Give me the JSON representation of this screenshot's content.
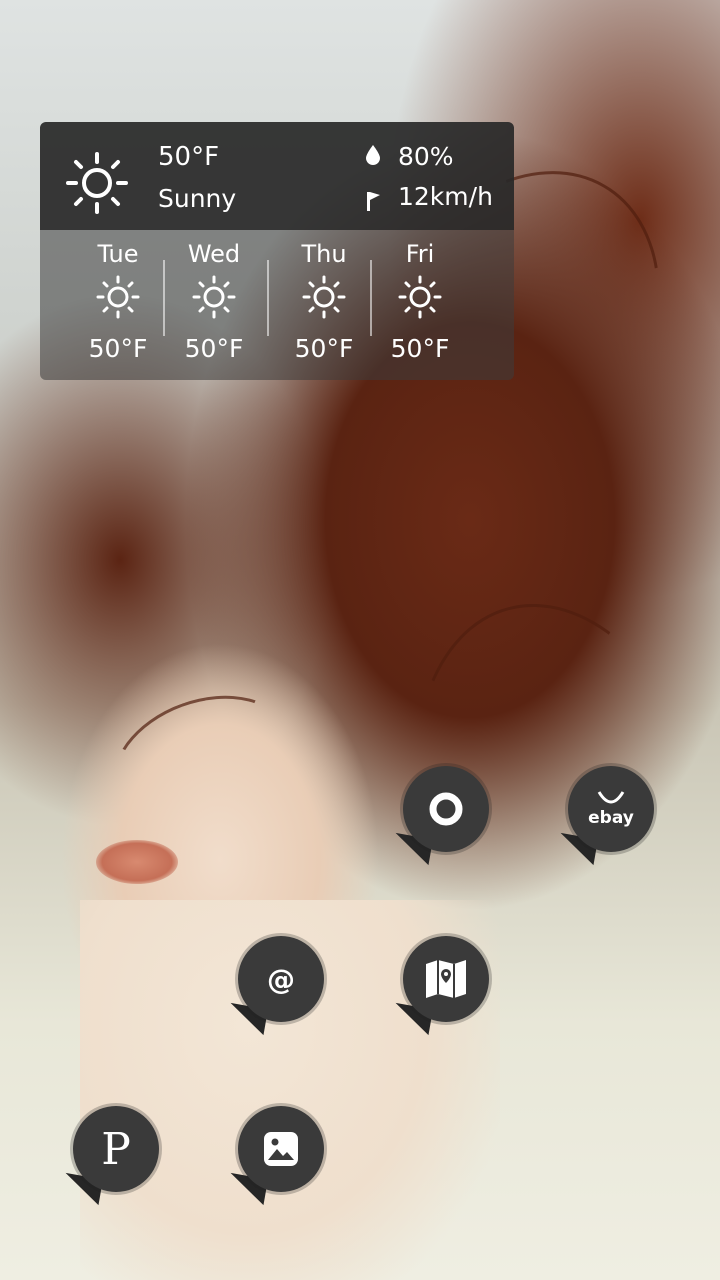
{
  "weather": {
    "current": {
      "temperature": "50°F",
      "condition": "Sunny",
      "humidity": "80%",
      "wind": "12km/h",
      "icon": "sun-icon"
    },
    "forecast": [
      {
        "day": "Tue",
        "temp": "50°F",
        "icon": "sun-icon"
      },
      {
        "day": "Wed",
        "temp": "50°F",
        "icon": "sun-icon"
      },
      {
        "day": "Thu",
        "temp": "50°F",
        "icon": "sun-icon"
      },
      {
        "day": "Fri",
        "temp": "50°F",
        "icon": "sun-icon"
      }
    ]
  },
  "apps": [
    {
      "name": "opera",
      "icon": "opera-ring-icon"
    },
    {
      "name": "ebay",
      "icon": "ebay-icon",
      "logo_text": "ebay"
    },
    {
      "name": "email",
      "icon": "at-sign-icon",
      "glyph": "@"
    },
    {
      "name": "maps",
      "icon": "folded-map-icon"
    },
    {
      "name": "pinterest",
      "icon": "pinterest-p-icon",
      "glyph": "P"
    },
    {
      "name": "gallery",
      "icon": "photo-icon"
    }
  ],
  "colors": {
    "widget_dark": "#282828",
    "icon_bg": "#3a3a3a",
    "text": "#ffffff"
  }
}
